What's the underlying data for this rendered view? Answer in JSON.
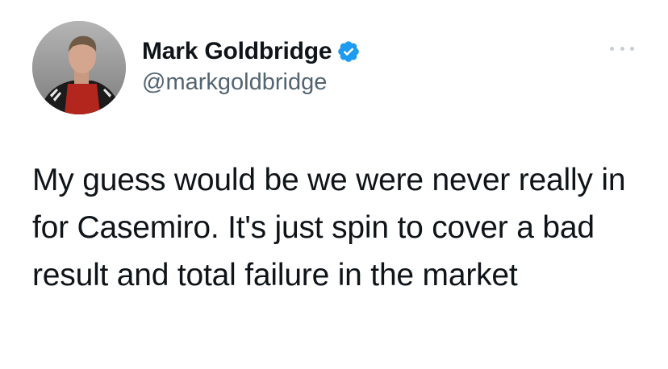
{
  "author": {
    "display_name": "Mark Goldbridge",
    "handle": "@markgoldbridge",
    "verified": true,
    "avatar_icon": "profile-photo"
  },
  "tweet": {
    "text": "My guess would be we were never really in for Casemiro. It's just spin to cover a bad result and total failure in the market"
  },
  "icons": {
    "verified": "verified-badge-icon",
    "more": "more-options-icon"
  },
  "colors": {
    "verified_blue": "#1d9bf0",
    "text": "#0f1419",
    "secondary_text": "#536471"
  }
}
